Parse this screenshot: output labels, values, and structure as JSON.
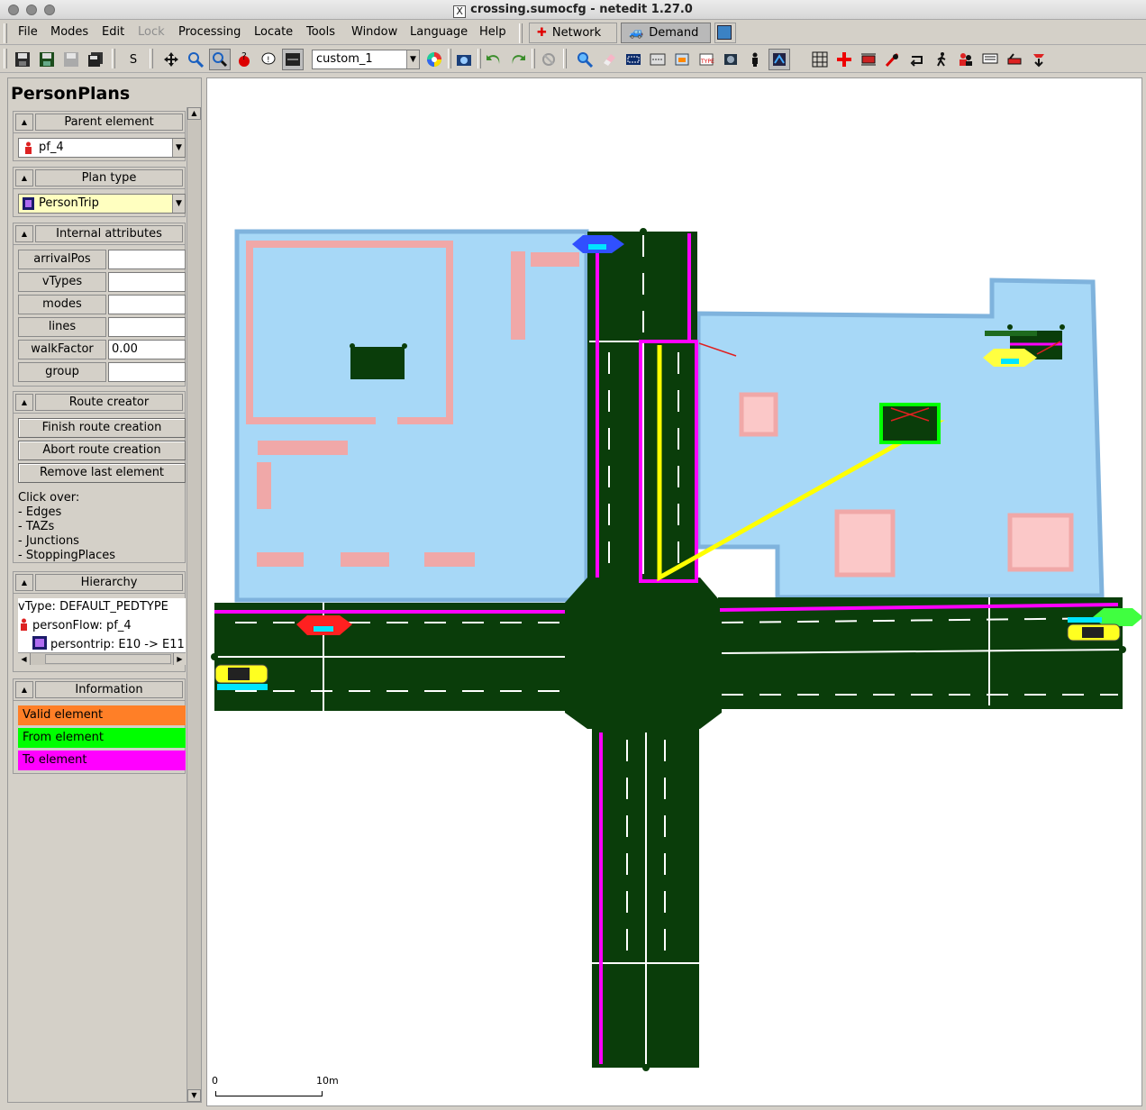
{
  "window": {
    "title": "crossing.sumocfg - netedit 1.27.0"
  },
  "menubar": {
    "items": [
      {
        "label": "File",
        "disabled": false
      },
      {
        "label": "Modes",
        "disabled": false
      },
      {
        "label": "Edit",
        "disabled": false
      },
      {
        "label": "Lock",
        "disabled": true
      },
      {
        "label": "Processing",
        "disabled": false
      },
      {
        "label": "Locate",
        "disabled": false
      },
      {
        "label": "Tools",
        "disabled": false
      },
      {
        "label": "Window",
        "disabled": false
      },
      {
        "label": "Language",
        "disabled": false
      },
      {
        "label": "Help",
        "disabled": false
      }
    ],
    "supermodes": [
      {
        "label": "Network",
        "active": false
      },
      {
        "label": "Demand",
        "active": true
      }
    ]
  },
  "toolbar": {
    "s_label": "S",
    "scheme": "custom_1"
  },
  "frame": {
    "title": "PersonPlans",
    "parent_element": {
      "title": "Parent element",
      "value": "pf_4"
    },
    "plan_type": {
      "title": "Plan type",
      "value": "PersonTrip"
    },
    "internal_attributes": {
      "title": "Internal attributes",
      "rows": [
        {
          "label": "arrivalPos",
          "value": ""
        },
        {
          "label": "vTypes",
          "value": ""
        },
        {
          "label": "modes",
          "value": ""
        },
        {
          "label": "lines",
          "value": ""
        },
        {
          "label": "walkFactor",
          "value": "0.00"
        },
        {
          "label": "group",
          "value": ""
        }
      ]
    },
    "route_creator": {
      "title": "Route creator",
      "finish": "Finish route creation",
      "abort": "Abort route creation",
      "remove": "Remove last element",
      "click_over": "Click over:",
      "targets": [
        "- Edges",
        "- TAZs",
        "- Junctions",
        "- StoppingPlaces"
      ]
    },
    "hierarchy": {
      "title": "Hierarchy",
      "vtype": "vType: DEFAULT_PEDTYPE",
      "person_flow": "personFlow: pf_4",
      "person_trip": "persontrip: E10 -> E11"
    },
    "information": {
      "title": "Information",
      "items": [
        {
          "label": "Valid element",
          "color": "#ff7f27"
        },
        {
          "label": "From element",
          "color": "#00ff00"
        },
        {
          "label": "To element",
          "color": "#ff00ff"
        }
      ]
    }
  },
  "canvas": {
    "scale_start": "0",
    "scale_end": "10m",
    "colors": {
      "road": "#0a3d0a",
      "taz": "#a7d8f7",
      "taz_border": "#7fb3dd",
      "building": "#f4a6a6",
      "highlight_path": "#ffff00",
      "to_element": "#ff00ff"
    }
  }
}
